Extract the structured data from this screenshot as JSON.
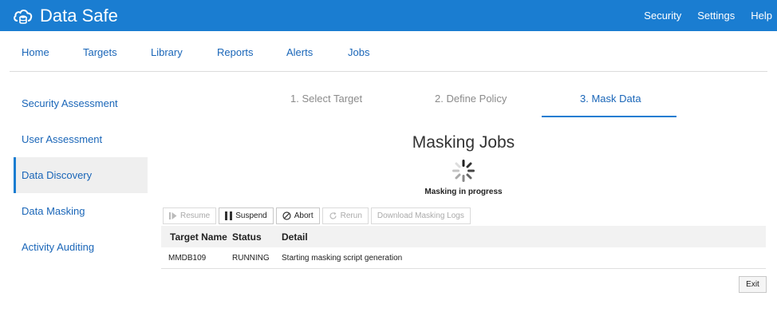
{
  "app": {
    "title": "Data Safe",
    "icon": "cloud-database-icon"
  },
  "top_links": [
    "Security",
    "Settings",
    "Help"
  ],
  "nav": [
    "Home",
    "Targets",
    "Library",
    "Reports",
    "Alerts",
    "Jobs"
  ],
  "sidebar": {
    "items": [
      {
        "label": "Security Assessment"
      },
      {
        "label": "User Assessment"
      },
      {
        "label": "Data Discovery",
        "active": true
      },
      {
        "label": "Data Masking"
      },
      {
        "label": "Activity Auditing"
      }
    ]
  },
  "steps": [
    {
      "label": "1. Select Target"
    },
    {
      "label": "2. Define Policy"
    },
    {
      "label": "3. Mask Data",
      "active": true
    }
  ],
  "masking": {
    "title": "Masking Jobs",
    "status_text": "Masking in progress"
  },
  "toolbar": {
    "resume": {
      "label": "Resume",
      "icon": "resume-icon",
      "enabled": false
    },
    "suspend": {
      "label": "Suspend",
      "icon": "pause-icon",
      "enabled": true
    },
    "abort": {
      "label": "Abort",
      "icon": "abort-icon",
      "enabled": true
    },
    "rerun": {
      "label": "Rerun",
      "icon": "rerun-icon",
      "enabled": false
    },
    "download": {
      "label": "Download Masking Logs",
      "enabled": false
    }
  },
  "table": {
    "headers": [
      "Target Name",
      "Status",
      "Detail"
    ],
    "rows": [
      [
        "MMDB109",
        "RUNNING",
        "Starting masking script generation"
      ]
    ]
  },
  "exit_label": "Exit",
  "colors": {
    "brand": "#1a7dd1",
    "link": "#1a66b8",
    "muted": "#8b8b8b"
  }
}
